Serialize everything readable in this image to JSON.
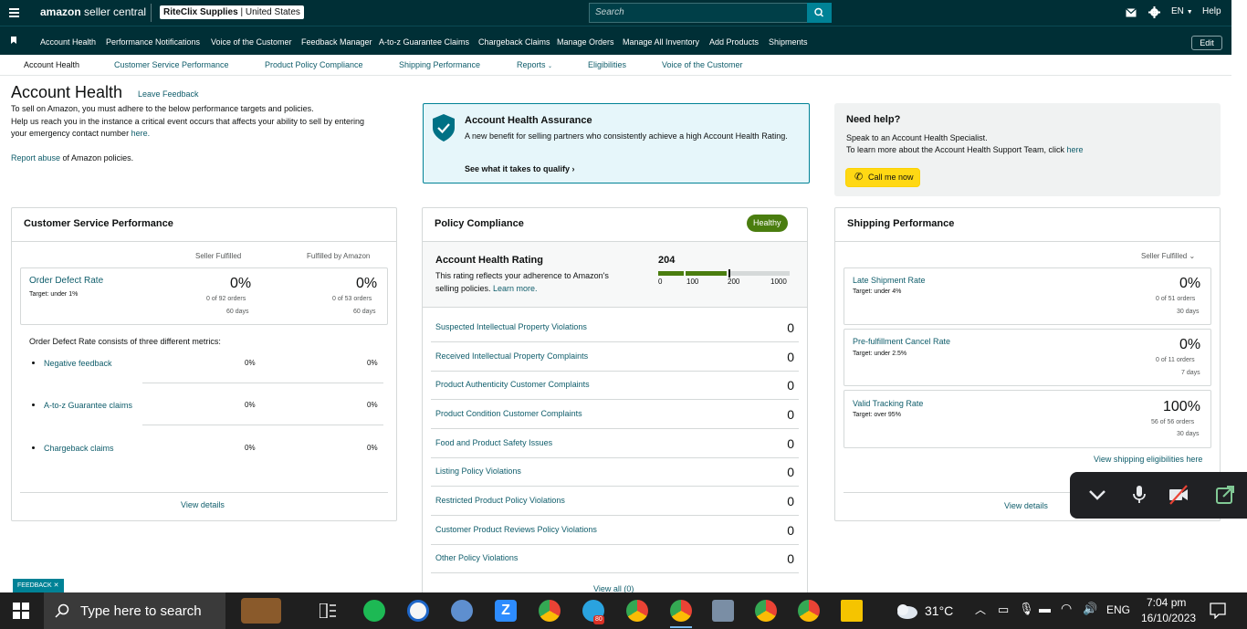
{
  "topbar": {
    "brand_prefix": "amazon",
    "brand_suffix": " seller central",
    "store_name": "RiteClix Supplies",
    "store_country": " | United States",
    "search_placeholder": "Search",
    "language": "EN",
    "help": "Help"
  },
  "nav": {
    "items": [
      "Account Health",
      "Performance Notifications",
      "Voice of the Customer",
      "Feedback Manager",
      "A-to-z Guarantee Claims",
      "Chargeback Claims",
      "Manage Orders",
      "Manage All Inventory",
      "Add Products",
      "Shipments"
    ],
    "edit": "Edit"
  },
  "subnav": {
    "items": [
      "Account Health",
      "Customer Service Performance",
      "Product Policy Compliance",
      "Shipping Performance",
      "Reports",
      "Eligibilities",
      "Voice of the Customer"
    ]
  },
  "header": {
    "title": "Account Health",
    "leave_feedback": "Leave Feedback",
    "line1": "To sell on Amazon, you must adhere to the below performance targets and policies.",
    "line2": "Help us reach you in the instance a critical event occurs that affects your ability to sell by entering",
    "line3_text": "your emergency contact number ",
    "line3_link": "here.",
    "report_link": "Report abuse",
    "report_text": " of Amazon policies."
  },
  "assurance": {
    "title": "Account Health Assurance",
    "body": "A new benefit for selling partners who consistently achieve a high Account Health Rating.",
    "link": "See what it takes to qualify"
  },
  "help": {
    "title": "Need help?",
    "line1": "Speak to an Account Health Specialist.",
    "line2_text": "To learn more about the Account Health Support Team, click ",
    "line2_link": "here",
    "call_button": "Call me now"
  },
  "csp": {
    "title": "Customer Service Performance",
    "col_seller": "Seller Fulfilled",
    "col_fba": "Fulfilled by Amazon",
    "odr_label": "Order Defect Rate",
    "odr_target": "Target: under 1%",
    "seller_value": "0%",
    "seller_orders": "0 of 92 orders",
    "seller_days": "60 days",
    "fba_value": "0%",
    "fba_orders": "0 of 53 orders",
    "fba_days": "60 days",
    "metrics_intro": "Order Defect Rate consists of three different metrics:",
    "metrics": [
      {
        "label": "Negative feedback",
        "seller": "0%",
        "fba": "0%"
      },
      {
        "label": "A-to-z Guarantee claims",
        "seller": "0%",
        "fba": "0%"
      },
      {
        "label": "Chargeback claims",
        "seller": "0%",
        "fba": "0%"
      }
    ],
    "view_details": "View details"
  },
  "policy": {
    "title": "Policy Compliance",
    "badge": "Healthy",
    "ahr_title": "Account Health Rating",
    "ahr_line1": "This rating reflects your adherence to Amazon's",
    "ahr_line2": "selling policies. ",
    "ahr_link": "Learn more.",
    "rating": "204",
    "scale": [
      "0",
      "100",
      "200",
      "1000"
    ],
    "rows": [
      {
        "label": "Suspected Intellectual Property Violations",
        "value": "0"
      },
      {
        "label": "Received Intellectual Property Complaints",
        "value": "0"
      },
      {
        "label": "Product Authenticity Customer Complaints",
        "value": "0"
      },
      {
        "label": "Product Condition Customer Complaints",
        "value": "0"
      },
      {
        "label": "Food and Product Safety Issues",
        "value": "0"
      },
      {
        "label": "Listing Policy Violations",
        "value": "0"
      },
      {
        "label": "Restricted Product Policy Violations",
        "value": "0"
      },
      {
        "label": "Customer Product Reviews Policy Violations",
        "value": "0"
      },
      {
        "label": "Other Policy Violations",
        "value": "0"
      }
    ],
    "view_all": "View all (0)"
  },
  "shipping": {
    "title": "Shipping Performance",
    "filter": "Seller Fulfilled",
    "metrics": [
      {
        "label": "Late Shipment Rate",
        "target": "Target: under 4%",
        "value": "0%",
        "orders": "0 of 51 orders",
        "days": "30 days"
      },
      {
        "label": "Pre-fulfillment Cancel Rate",
        "target": "Target: under 2.5%",
        "value": "0%",
        "orders": "0 of 11 orders",
        "days": "7 days"
      },
      {
        "label": "Valid Tracking Rate",
        "target": "Target: over 95%",
        "value": "100%",
        "orders": "56 of 56 orders",
        "days": "30 days"
      }
    ],
    "eligibilities_link": "View shipping eligibilities here",
    "view_details": "View details"
  },
  "feedback_tab": "FEEDBACK ✕",
  "taskbar": {
    "search_placeholder": "Type here to search",
    "temperature": "31°C",
    "language": "ENG",
    "time": "7:04 pm",
    "date": "16/10/2023",
    "telegram_badge": "80"
  },
  "colors": {
    "header_bg": "#002f36",
    "link": "#0f5d6b",
    "healthy_green": "#4a7d0f",
    "assurance_bg": "#e6f6fa",
    "call_button": "#ffd814"
  }
}
